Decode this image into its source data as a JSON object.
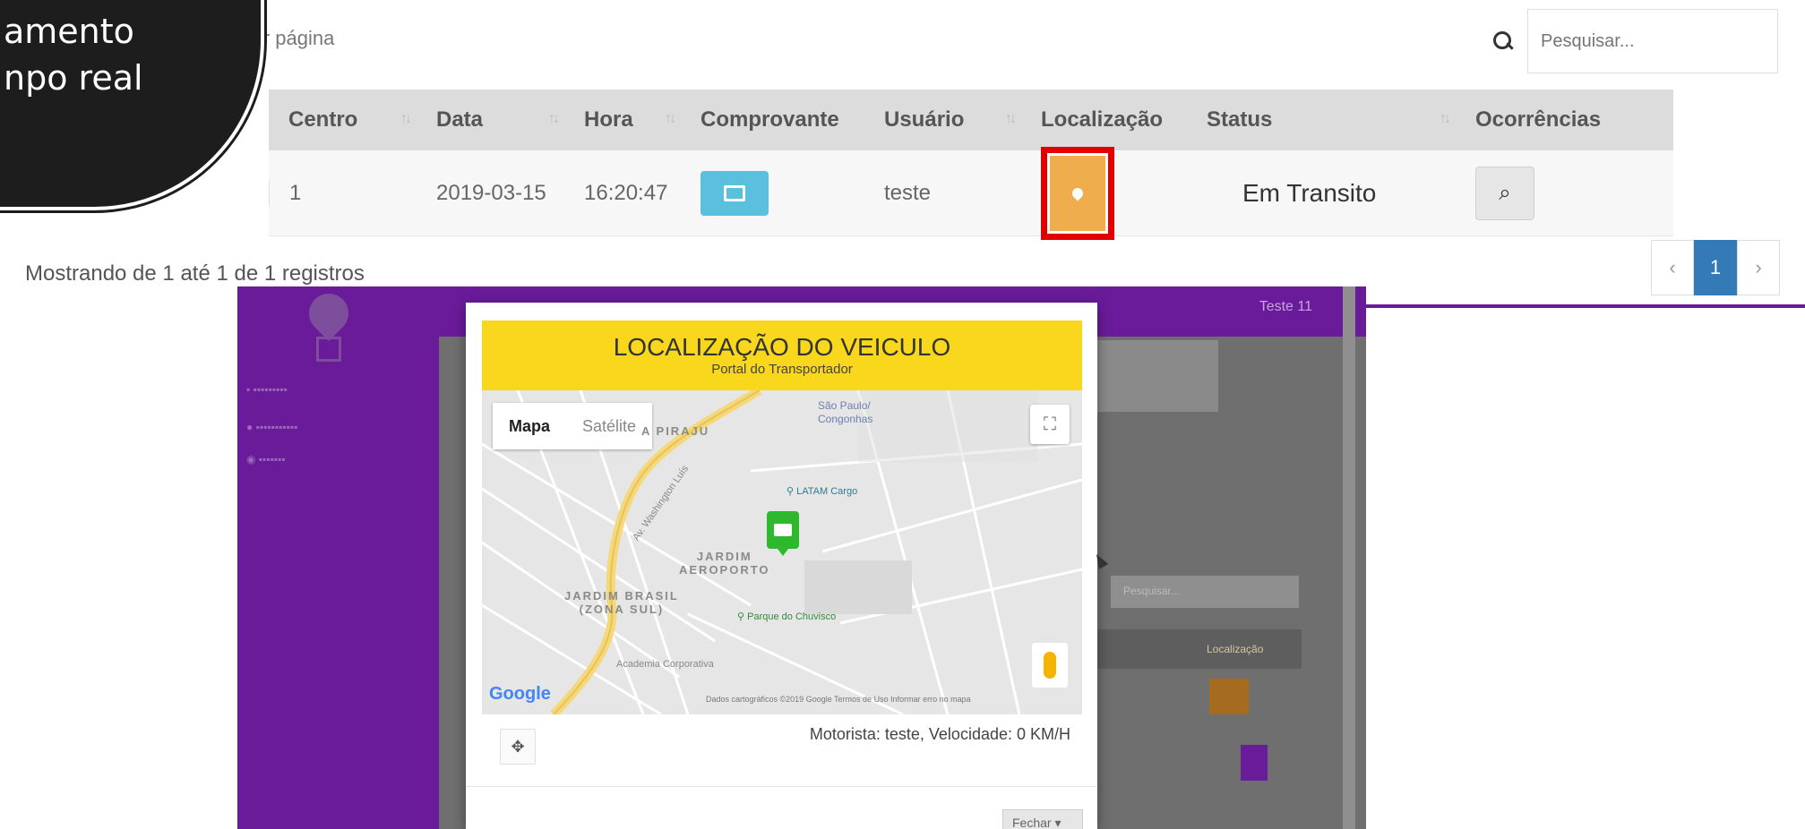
{
  "controls": {
    "per_page_text": "os por página",
    "search_placeholder": "Pesquisar..."
  },
  "callout": {
    "line1": "amento",
    "line2": "npo real"
  },
  "table": {
    "headers": [
      "Centro",
      "Data",
      "Hora",
      "Comprovante",
      "Usuário",
      "Localização",
      "Status",
      "Ocorrências"
    ],
    "rows": [
      {
        "centro": "1",
        "data": "2019-03-15",
        "hora": "16:20:47",
        "comprovante_icon": "image-icon",
        "usuario": "teste",
        "localizacao_icon": "map-marker-icon",
        "status": "Em Transito",
        "ocorrencias_icon": "search-icon"
      }
    ]
  },
  "footer": {
    "showing": "Mostrando de 1 até 1 de 1 registros",
    "pagination": {
      "prev": "‹",
      "current": "1",
      "next": "›"
    }
  },
  "colors": {
    "brand_purple": "#6a1b9a",
    "header_yellow": "#f9d71c",
    "highlight_red": "#e00000",
    "button_orange": "#f0ad4e",
    "button_blue": "#5bc0de",
    "page_active": "#337ab7"
  },
  "embedded": {
    "user_label": "Teste 11",
    "search_placeholder": "Pesquisar...",
    "table_header": "Localização",
    "modal": {
      "title": "LOCALIZAÇÃO DO VEICULO",
      "subtitle": "Portal do Transportador",
      "map_tabs": [
        "Mapa",
        "Satélite"
      ],
      "places": {
        "piraju": "A PIRAJU",
        "sao_paulo": "São Paulo/\nCongonhas",
        "jardim_aeroporto": "JARDIM\nAEROPORTO",
        "jardim_brasil": "JARDIM BRASIL\n(ZONA SUL)",
        "latam": "LATAM Cargo",
        "parque": "Parque do Chuvisco",
        "avenida": "Av. Washington Luís",
        "academia": "Academia Corporativa"
      },
      "google_logo": "Google",
      "map_attribution": "Dados cartográficos ©2019 Google   Termos de Uso   Informar erro no mapa",
      "driver_info": "Motorista: teste, Velocidade: 0 KM/H",
      "close_button": "Fechar ▾"
    }
  }
}
